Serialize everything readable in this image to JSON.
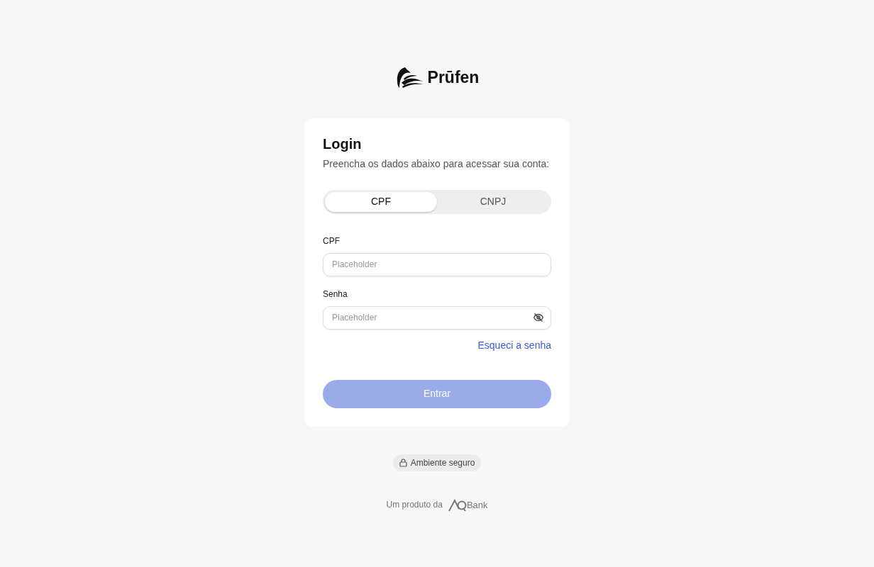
{
  "brand": {
    "name": "Prūfen"
  },
  "login": {
    "title": "Login",
    "subtitle": "Preencha os dados abaixo para acessar sua conta:",
    "tabs": [
      {
        "label": "CPF",
        "selected": true
      },
      {
        "label": "CNPJ",
        "selected": false
      }
    ],
    "fields": [
      {
        "label": "CPF",
        "placeholder": "Placeholder",
        "kind": "text"
      },
      {
        "label": "Senha",
        "placeholder": "Placeholder",
        "kind": "password"
      }
    ],
    "forgot_link": "Esqueci a senha",
    "submit": {
      "label": "Entrar",
      "disabled": true
    }
  },
  "secure_badge": "Ambiente seguro",
  "footer": {
    "text": "Um produto da",
    "partner": "Bank"
  }
}
